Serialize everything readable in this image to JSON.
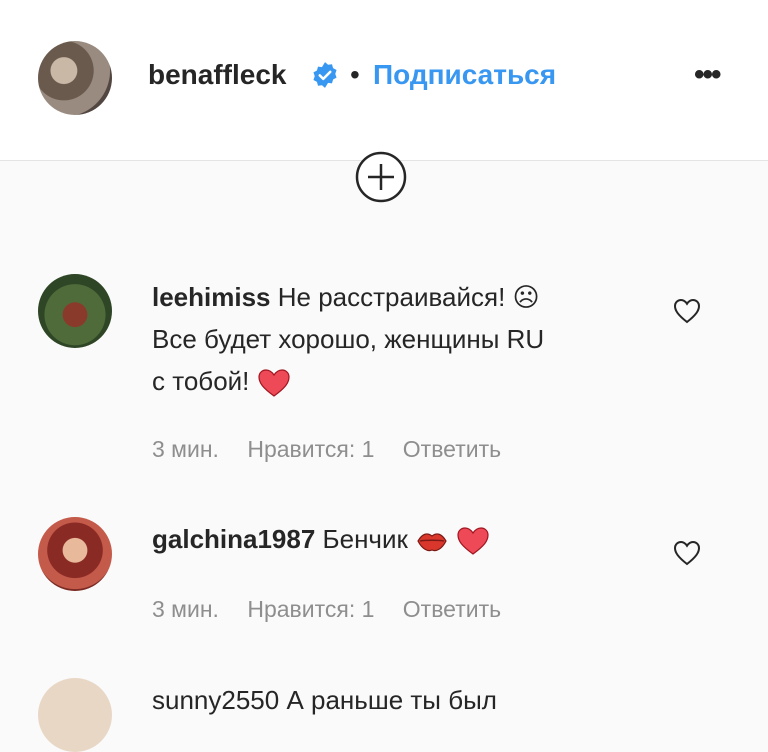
{
  "post_header": {
    "username": "benaffleck",
    "separator": "•",
    "follow_label": "Подписаться",
    "more_label": "•••"
  },
  "comments": [
    {
      "username": "leehimiss",
      "text_line1": "Не расстраивайся! ☹",
      "text_line2": "Все будет хорошо, женщины RU",
      "text_line3": "с тобой!",
      "time": "3 мин.",
      "likes": "Нравится: 1",
      "reply": "Ответить"
    },
    {
      "username": "galchina1987",
      "text": "Бенчик",
      "time": "3 мин.",
      "likes": "Нравится: 1",
      "reply": "Ответить"
    }
  ],
  "partial_comment": {
    "text": "sunny2550 А раньше ты был"
  },
  "colors": {
    "link_blue": "#3897f0",
    "meta_gray": "#8e8e8e",
    "heart_red": "#ed4956"
  }
}
